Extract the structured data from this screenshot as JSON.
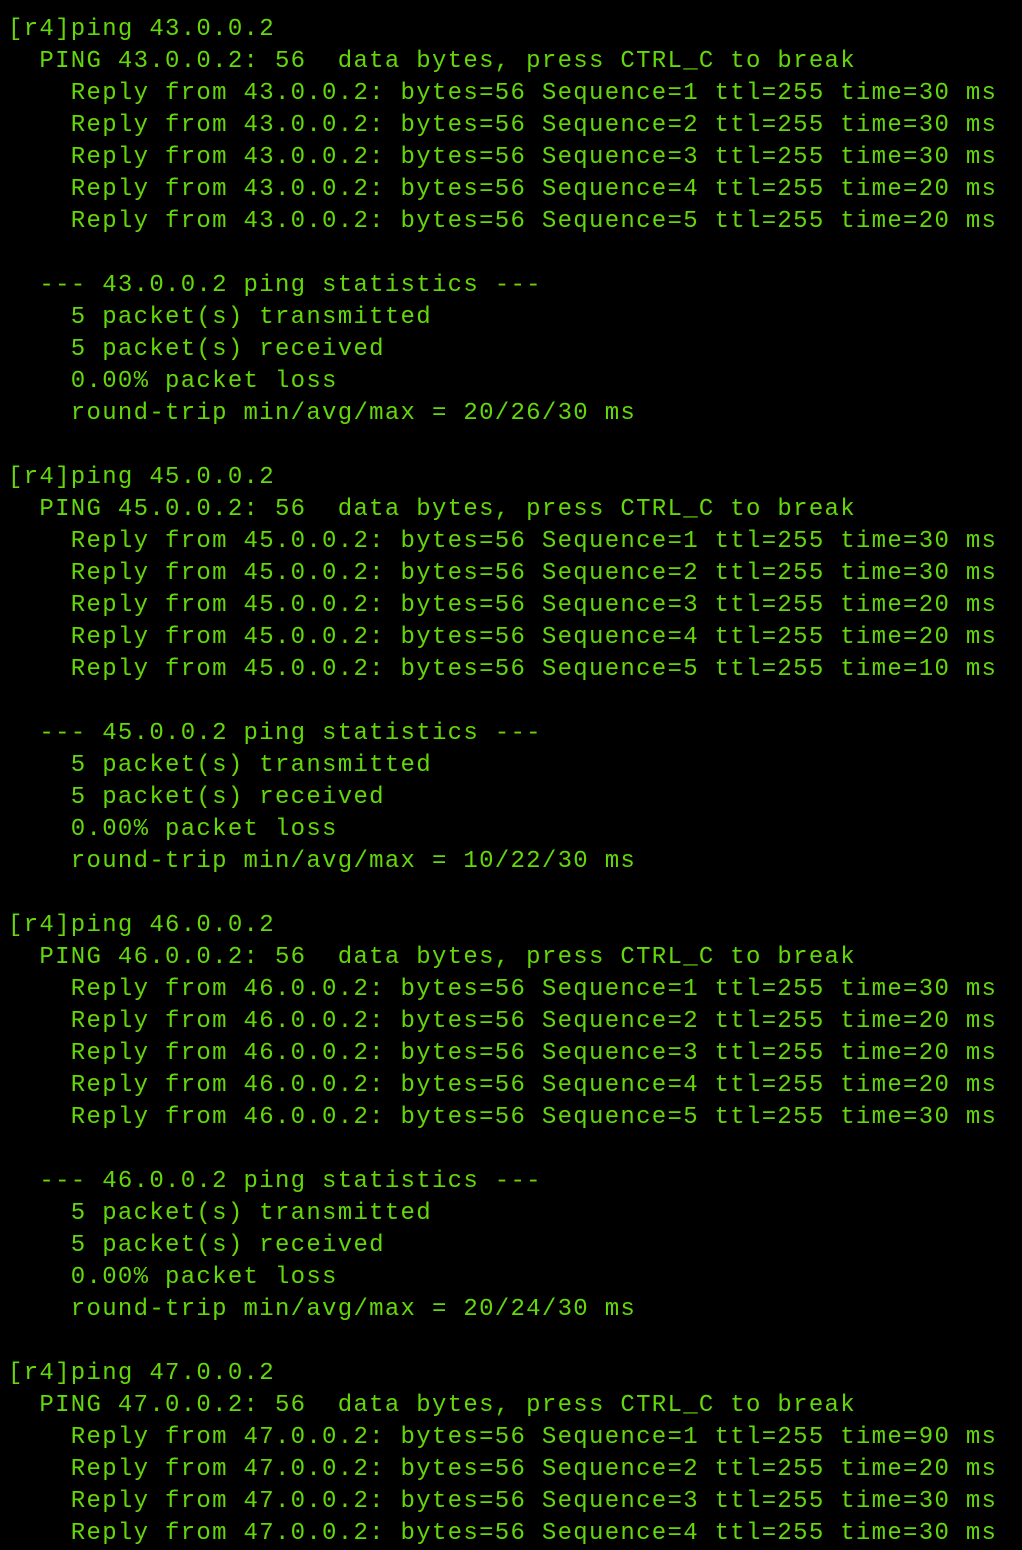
{
  "terminal": {
    "text_color": "#64d80a",
    "background": "#000000",
    "lines": [
      "[r4]ping 43.0.0.2",
      "  PING 43.0.0.2: 56  data bytes, press CTRL_C to break",
      "    Reply from 43.0.0.2: bytes=56 Sequence=1 ttl=255 time=30 ms",
      "    Reply from 43.0.0.2: bytes=56 Sequence=2 ttl=255 time=30 ms",
      "    Reply from 43.0.0.2: bytes=56 Sequence=3 ttl=255 time=30 ms",
      "    Reply from 43.0.0.2: bytes=56 Sequence=4 ttl=255 time=20 ms",
      "    Reply from 43.0.0.2: bytes=56 Sequence=5 ttl=255 time=20 ms",
      "",
      "  --- 43.0.0.2 ping statistics ---",
      "    5 packet(s) transmitted",
      "    5 packet(s) received",
      "    0.00% packet loss",
      "    round-trip min/avg/max = 20/26/30 ms",
      "",
      "[r4]ping 45.0.0.2",
      "  PING 45.0.0.2: 56  data bytes, press CTRL_C to break",
      "    Reply from 45.0.0.2: bytes=56 Sequence=1 ttl=255 time=30 ms",
      "    Reply from 45.0.0.2: bytes=56 Sequence=2 ttl=255 time=30 ms",
      "    Reply from 45.0.0.2: bytes=56 Sequence=3 ttl=255 time=20 ms",
      "    Reply from 45.0.0.2: bytes=56 Sequence=4 ttl=255 time=20 ms",
      "    Reply from 45.0.0.2: bytes=56 Sequence=5 ttl=255 time=10 ms",
      "",
      "  --- 45.0.0.2 ping statistics ---",
      "    5 packet(s) transmitted",
      "    5 packet(s) received",
      "    0.00% packet loss",
      "    round-trip min/avg/max = 10/22/30 ms",
      "",
      "[r4]ping 46.0.0.2",
      "  PING 46.0.0.2: 56  data bytes, press CTRL_C to break",
      "    Reply from 46.0.0.2: bytes=56 Sequence=1 ttl=255 time=30 ms",
      "    Reply from 46.0.0.2: bytes=56 Sequence=2 ttl=255 time=20 ms",
      "    Reply from 46.0.0.2: bytes=56 Sequence=3 ttl=255 time=20 ms",
      "    Reply from 46.0.0.2: bytes=56 Sequence=4 ttl=255 time=20 ms",
      "    Reply from 46.0.0.2: bytes=56 Sequence=5 ttl=255 time=30 ms",
      "",
      "  --- 46.0.0.2 ping statistics ---",
      "    5 packet(s) transmitted",
      "    5 packet(s) received",
      "    0.00% packet loss",
      "    round-trip min/avg/max = 20/24/30 ms",
      "",
      "[r4]ping 47.0.0.2",
      "  PING 47.0.0.2: 56  data bytes, press CTRL_C to break",
      "    Reply from 47.0.0.2: bytes=56 Sequence=1 ttl=255 time=90 ms",
      "    Reply from 47.0.0.2: bytes=56 Sequence=2 ttl=255 time=20 ms",
      "    Reply from 47.0.0.2: bytes=56 Sequence=3 ttl=255 time=30 ms",
      "    Reply from 47.0.0.2: bytes=56 Sequence=4 ttl=255 time=30 ms"
    ]
  }
}
